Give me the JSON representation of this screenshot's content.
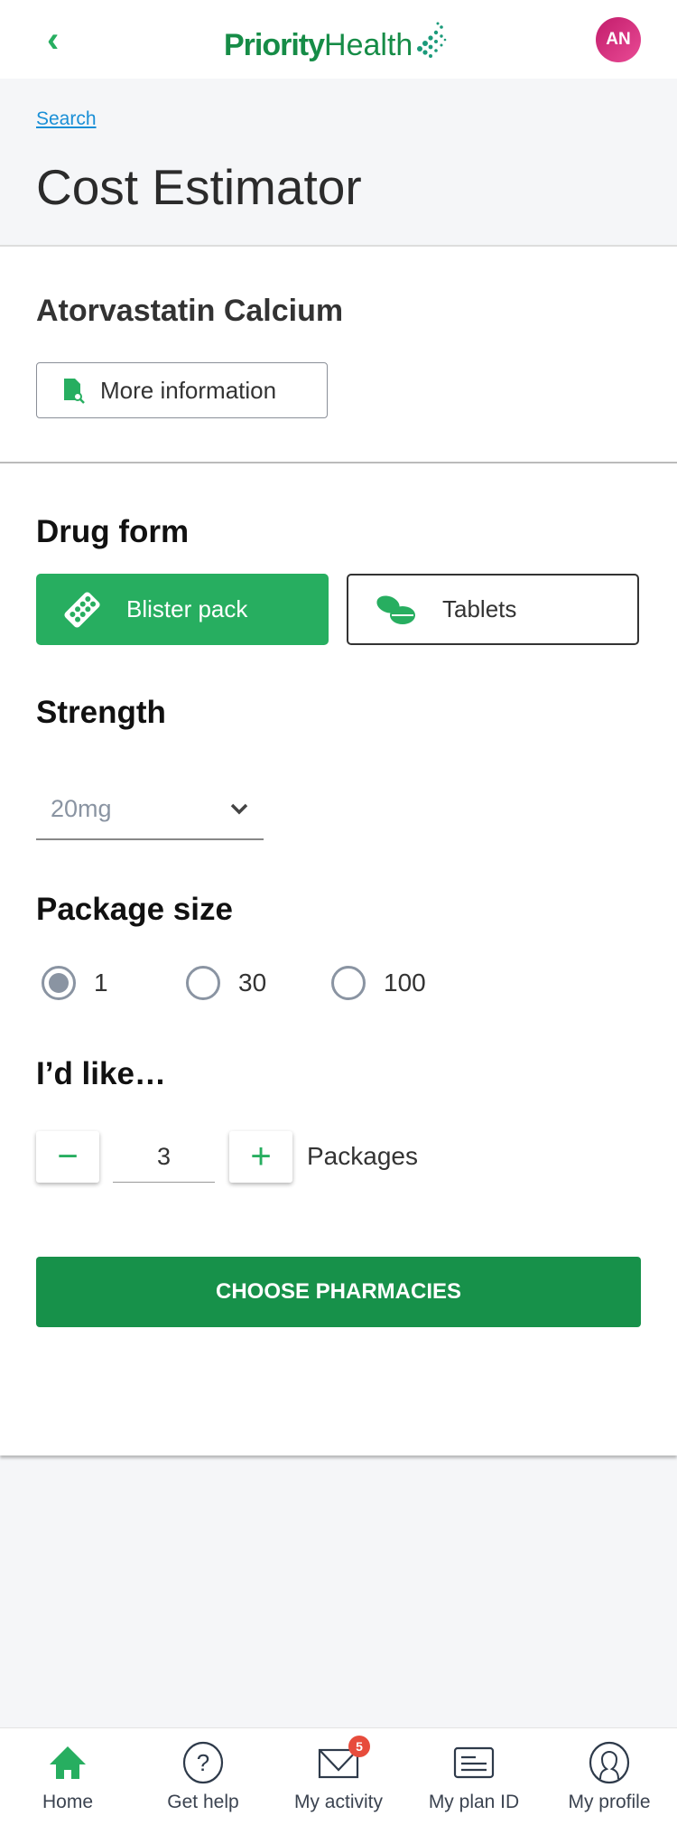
{
  "header": {
    "logo_bold": "Priority",
    "logo_light": "Health",
    "avatar": "AN"
  },
  "breadcrumb": "Search",
  "title": "Cost Estimator",
  "drug": {
    "name": "Atorvastatin Calcium",
    "more_info": "More information"
  },
  "drug_form": {
    "label": "Drug form",
    "options": [
      "Blister pack",
      "Tablets"
    ],
    "selected": "Blister pack"
  },
  "strength": {
    "label": "Strength",
    "value": "20mg"
  },
  "package_size": {
    "label": "Package size",
    "options": [
      "1",
      "30",
      "100"
    ],
    "selected": "1"
  },
  "quantity": {
    "label": "I’d like…",
    "value": "3",
    "unit": "Packages"
  },
  "cta": "CHOOSE PHARMACIES",
  "colors": {
    "accent": "#27ae60",
    "cta": "#17914a",
    "badge": "#e74c3c"
  },
  "nav": {
    "items": [
      "Home",
      "Get help",
      "My activity",
      "My plan ID",
      "My profile"
    ],
    "activity_badge": "5",
    "active": "Home"
  }
}
